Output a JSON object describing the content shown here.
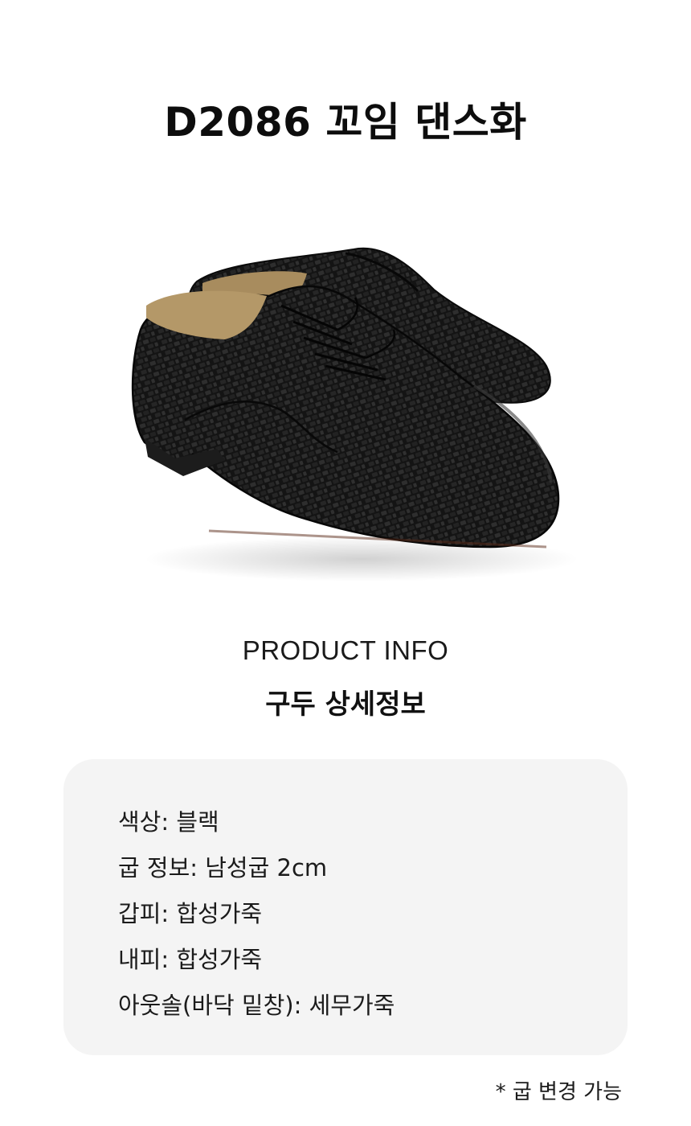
{
  "header": {
    "title": "D2086 꼬임 댄스화"
  },
  "image": {
    "icon": "woven-leather-dance-shoes",
    "color": "#111111"
  },
  "section": {
    "label": "PRODUCT INFO",
    "title": "구두 상세정보"
  },
  "info_items": [
    "색상: 블랙",
    "굽 정보: 남성굽 2cm",
    "갑피: 합성가죽",
    "내피: 합성가죽",
    "아웃솔(바닥 밑창): 세무가죽"
  ],
  "footnote": "* 굽 변경 가능",
  "colors": {
    "card_bg": "#f4f4f4",
    "text": "#111111"
  }
}
